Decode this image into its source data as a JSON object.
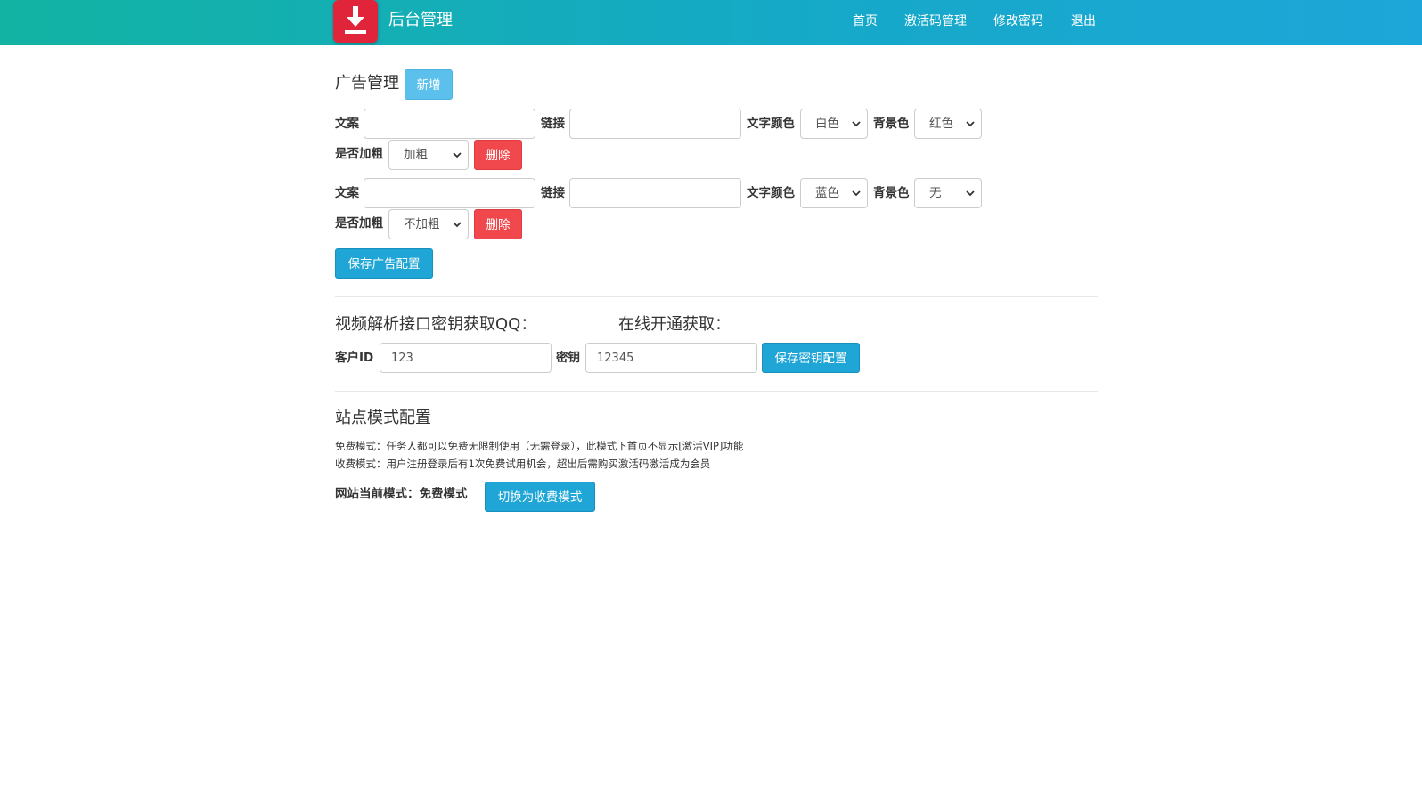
{
  "header": {
    "brand": "后台管理",
    "nav": [
      "首页",
      "激活码管理",
      "修改密码",
      "退出"
    ],
    "logo_icon": "download-icon",
    "logo_color": "#e0253b"
  },
  "ads": {
    "title": "广告管理",
    "add_label": "新增",
    "labels": {
      "text": "文案",
      "link": "链接",
      "text_color": "文字颜色",
      "bg_color": "背景色",
      "bold": "是否加粗"
    },
    "delete_label": "删除",
    "rows": [
      {
        "text": "",
        "link": "",
        "text_color": "白色",
        "bg_color": "红色",
        "bold": "加粗"
      },
      {
        "text": "",
        "link": "",
        "text_color": "蓝色",
        "bg_color": "无",
        "bold": "不加粗"
      }
    ],
    "save_label": "保存广告配置"
  },
  "api": {
    "title_qq": "视频解析接口密钥获取QQ：",
    "title_online": "在线开通获取：",
    "client_id_label": "客户ID",
    "client_id_value": "123",
    "key_label": "密钥",
    "key_value": "12345",
    "save_label": "保存密钥配置"
  },
  "mode": {
    "title": "站点模式配置",
    "free_desc": "免费模式：任务人都可以免费无限制使用（无需登录），此模式下首页不显示[激活VIP]功能",
    "paid_desc": "收费模式：用户注册登录后有1次免费试用机会，超出后需购买激活码激活成为会员",
    "current_label": "网站当前模式：免费模式",
    "switch_label": "切换为收费模式"
  },
  "colors": {
    "header_start": "#12b3a3",
    "header_end": "#1da6d9",
    "primary": "#1fa6d6",
    "danger": "#f0484c"
  }
}
